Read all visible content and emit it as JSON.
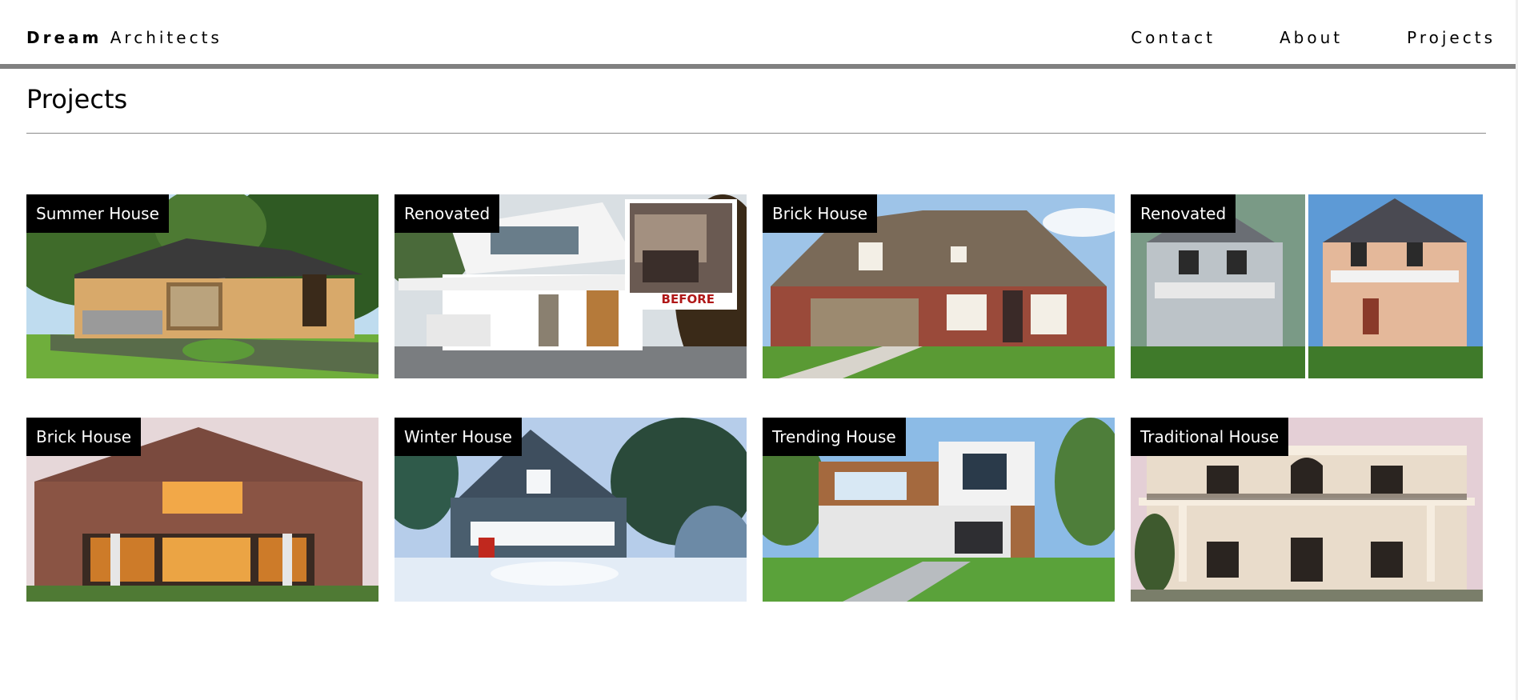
{
  "header": {
    "brand_bold": "Dream",
    "brand_rest": "Architects",
    "nav": [
      {
        "label": "Contact"
      },
      {
        "label": "About"
      },
      {
        "label": "Projects"
      }
    ]
  },
  "main": {
    "title": "Projects",
    "projects": [
      {
        "label": "Summer House"
      },
      {
        "label": "Renovated"
      },
      {
        "label": "Brick House"
      },
      {
        "label": "Renovated"
      },
      {
        "label": "Brick House"
      },
      {
        "label": "Winter House"
      },
      {
        "label": "Trending House"
      },
      {
        "label": "Traditional House"
      }
    ],
    "before_label": "BEFORE"
  }
}
